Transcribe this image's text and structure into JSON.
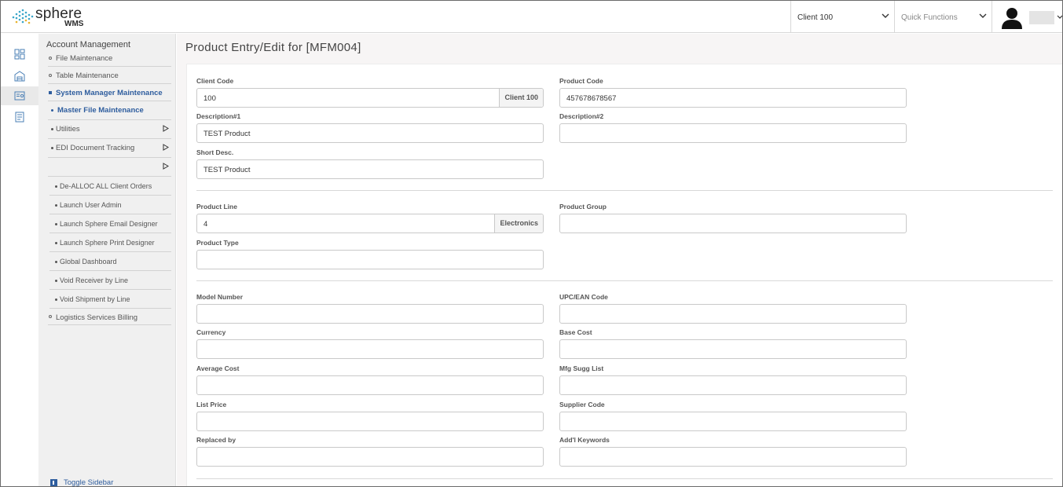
{
  "header": {
    "logo_word": "sphere",
    "logo_sub": "WMS",
    "client_select": "Client 100",
    "quick_functions": "Quick Functions"
  },
  "rail": {
    "icons": [
      "dashboard-icon",
      "warehouse-icon",
      "system-manager-icon",
      "billing-icon"
    ]
  },
  "sidebar": {
    "heading": "Account Management",
    "items": [
      {
        "label": "File Maintenance"
      },
      {
        "label": "Table Maintenance"
      },
      {
        "label": "System Manager Maintenance"
      },
      {
        "label": "Master File Maintenance"
      },
      {
        "label": "Utilities"
      },
      {
        "label": "EDI Document Tracking"
      }
    ],
    "sub_items": [
      {
        "label": "De-ALLOC ALL Client Orders"
      },
      {
        "label": "Launch User Admin"
      },
      {
        "label": "Launch Sphere Email Designer"
      },
      {
        "label": "Launch Sphere Print Designer"
      },
      {
        "label": "Global Dashboard"
      },
      {
        "label": "Void Receiver by Line"
      },
      {
        "label": "Void Shipment by Line"
      }
    ],
    "last_item": "Logistics Services Billing",
    "toggle": "Toggle Sidebar"
  },
  "main": {
    "title": "Product Entry/Edit for [MFM004]",
    "fields": {
      "client_code": {
        "label": "Client Code",
        "value": "100",
        "addon": "Client 100"
      },
      "product_code": {
        "label": "Product Code",
        "value": "457678678567"
      },
      "description1": {
        "label": "Description#1",
        "value": "TEST Product"
      },
      "description2": {
        "label": "Description#2",
        "value": ""
      },
      "short_desc": {
        "label": "Short Desc.",
        "value": "TEST Product"
      },
      "product_line": {
        "label": "Product Line",
        "value": "4",
        "addon": "Electronics"
      },
      "product_group": {
        "label": "Product Group",
        "value": ""
      },
      "product_type": {
        "label": "Product Type",
        "value": ""
      },
      "model_number": {
        "label": "Model Number",
        "value": ""
      },
      "upc_ean": {
        "label": "UPC/EAN Code",
        "value": ""
      },
      "currency": {
        "label": "Currency",
        "value": ""
      },
      "base_cost": {
        "label": "Base Cost",
        "value": ""
      },
      "average_cost": {
        "label": "Average Cost",
        "value": ""
      },
      "mfg_sugg_list": {
        "label": "Mfg Sugg List",
        "value": ""
      },
      "list_price": {
        "label": "List Price",
        "value": ""
      },
      "supplier_code": {
        "label": "Supplier Code",
        "value": ""
      },
      "replaced_by": {
        "label": "Replaced by",
        "value": ""
      },
      "addl_keywords": {
        "label": "Add'l Keywords",
        "value": ""
      }
    }
  },
  "colors": {
    "accent": "#2e5d9e",
    "sidebar_bg": "#f0f0f0",
    "main_bg": "#f7f5f5"
  }
}
